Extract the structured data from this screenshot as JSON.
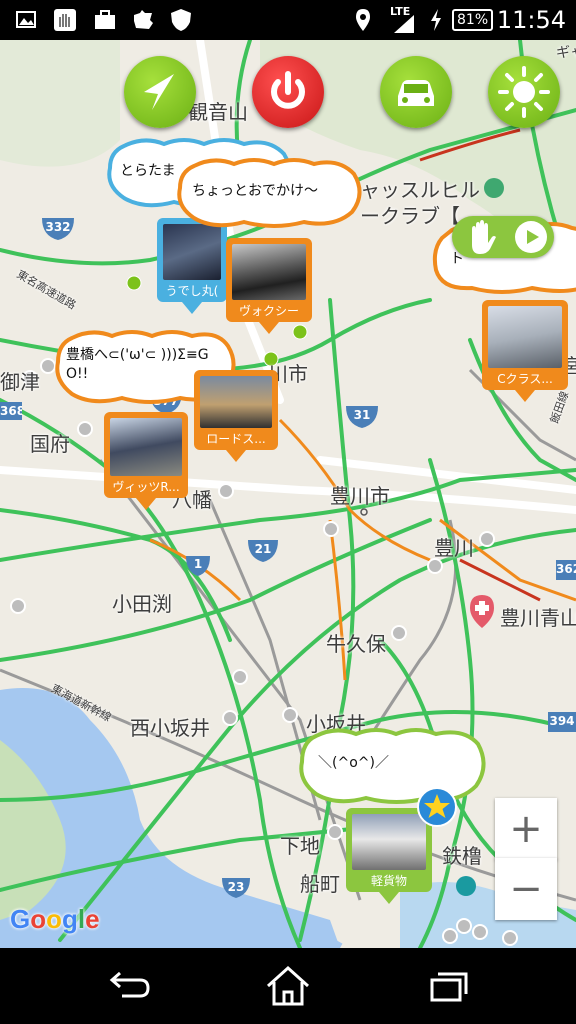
{
  "status_bar": {
    "lte": "LTE",
    "battery": "81%",
    "time": "11:54"
  },
  "map_labels": {
    "kannon": "観音山",
    "castle_hill": "ャッスルヒル",
    "club": "ークラブ【",
    "city_partial": "川市",
    "mito": "御津",
    "r368": "368",
    "kokufu": "国府",
    "yawata": "八幡",
    "toyokawa_shi": "豊川市",
    "toyokawa": "豊川",
    "r362": "362",
    "r21": "21",
    "r1": "1",
    "odabuchi": "小田渕",
    "toyokawa_aoyama": "豊川青山",
    "ushikubo": "牛久保",
    "nishikozakai": "西小坂井",
    "kozakai": "小坂井",
    "r394": "394",
    "shimoji": "下地",
    "funamachi": "船町",
    "kanaya": "鉄橹",
    "r23": "23",
    "r332": "332",
    "r377": "377",
    "r31": "31",
    "tomei": "東名高速道路",
    "tokaido": "東海道新幹線",
    "iida": "飯田線",
    "gya": "ギャ",
    "miya": "宮"
  },
  "top_buttons": {
    "navigate": "navigate",
    "power": "power",
    "car": "car",
    "brightness": "brightness"
  },
  "bubbles": {
    "b1": "とらたま",
    "b2": "ちょっとおでかけ〜",
    "b3": "豊橋へ⊂('ω'⊂ )))Σ≡GO!!",
    "b4": "ト",
    "b5": "＼(^o^)／"
  },
  "pins": {
    "p1": "うでし丸(",
    "p2": "ヴォクシー",
    "p3": "ロードス...",
    "p4": "ヴィッツR...",
    "p5": "Cクラス...",
    "p6": "軽貨物"
  },
  "zoom": {
    "in": "+",
    "out": "−"
  },
  "google": "Google",
  "colors": {
    "green_btn": "#7cc21a",
    "red_btn": "#d92020",
    "orange_pin": "#f08a1c",
    "blue_pin": "#4ab0e0",
    "green_pin": "#8cc63f"
  }
}
